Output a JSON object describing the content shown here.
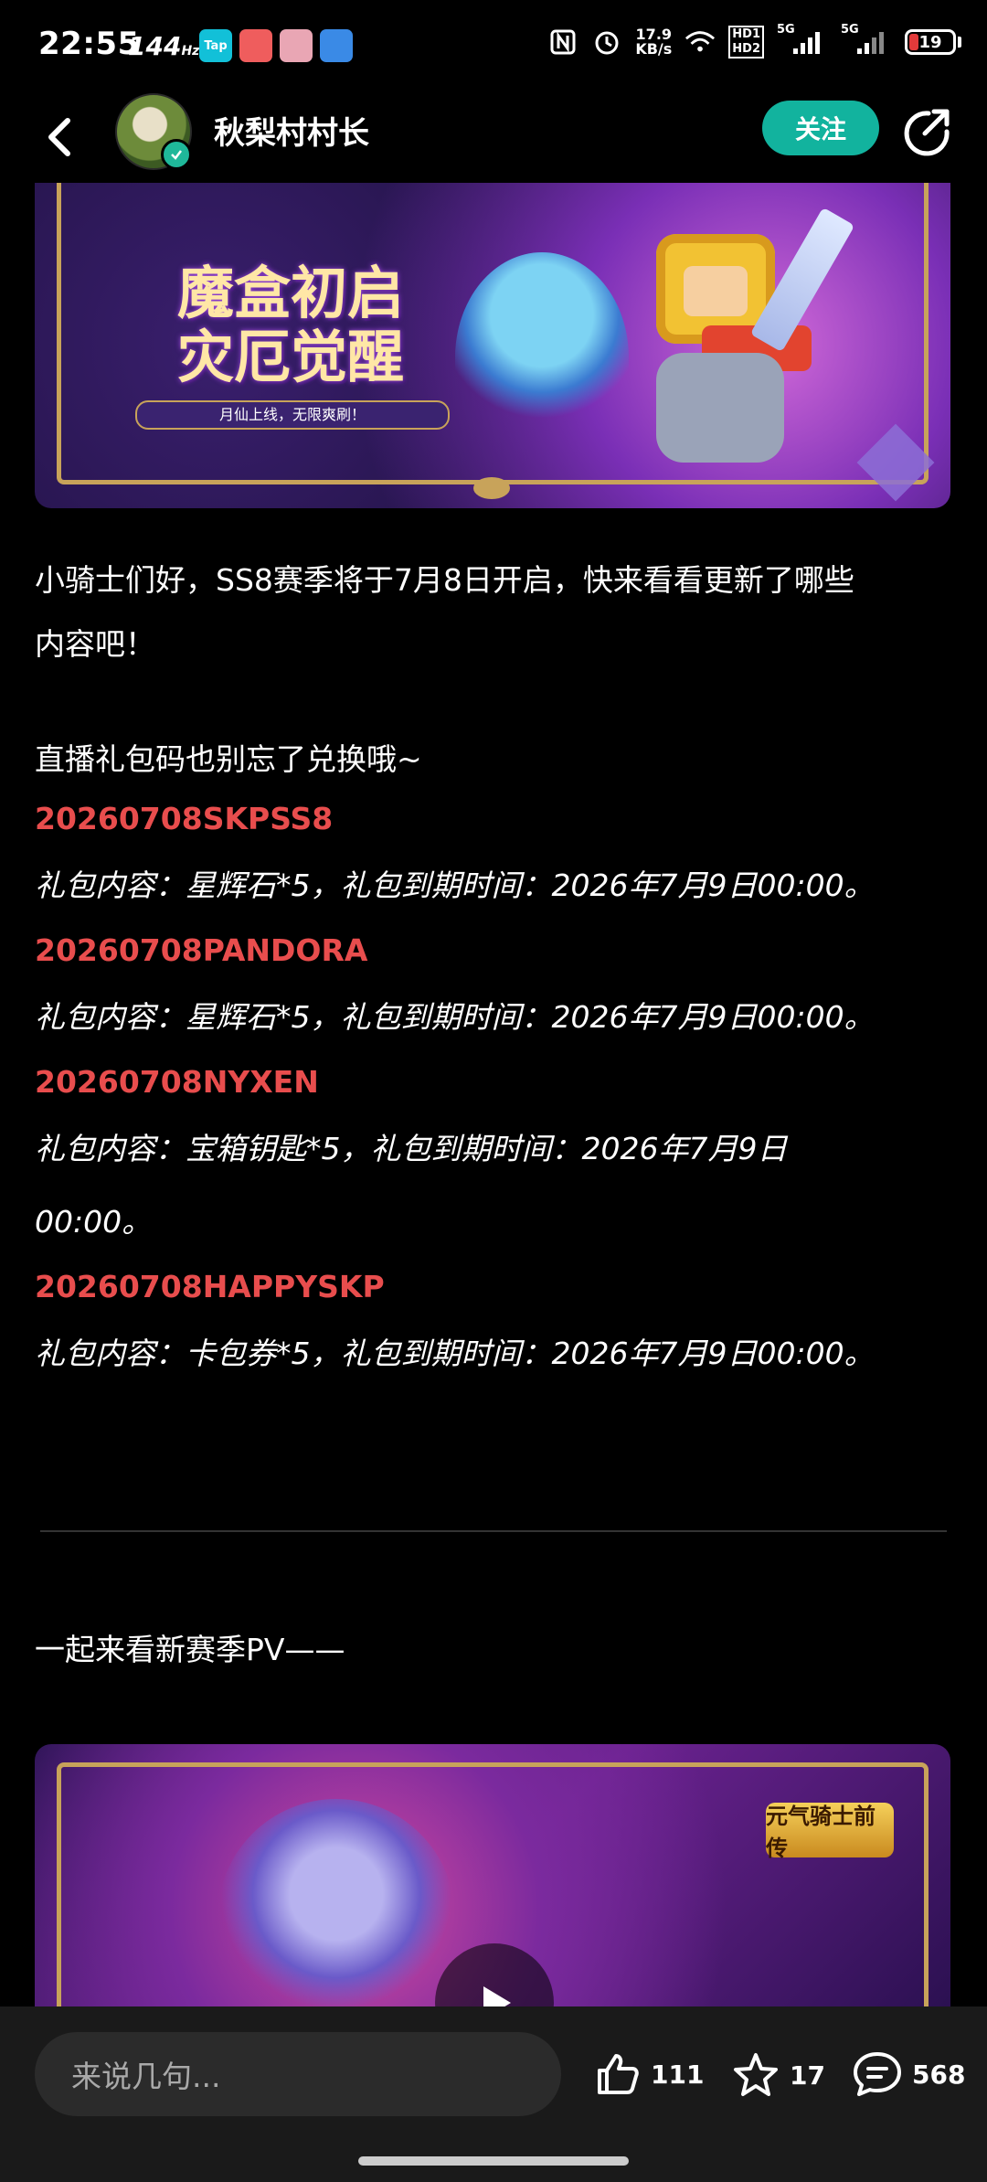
{
  "status_bar": {
    "time": "22:55",
    "refresh_rate": "144",
    "refresh_unit": "Hz",
    "net_speed_value": "17.9",
    "net_speed_unit": "KB/s",
    "hd1": "HD1",
    "hd2": "HD2",
    "sig1": "5G",
    "sig2": "5G",
    "battery": "19",
    "app_icons": [
      "tap-icon",
      "game-icon",
      "avatar-app-icon",
      "download-icon"
    ]
  },
  "header": {
    "author_name": "秋梨村村长",
    "follow_label": "关注"
  },
  "banner1": {
    "title_line1": "魔盒初启",
    "title_line2": "灾厄觉醒",
    "subtitle": "月仙上线，无限爽刷！"
  },
  "article": {
    "intro_line1": "小骑士们好，SS8赛季将于7月8日开启，快来看看更新了哪些",
    "intro_line2": "内容吧！",
    "reminder": "直播礼包码也别忘了兑换哦~",
    "codes": [
      {
        "code": "20260708SKPSS8",
        "content": "礼包内容：星辉石*5，礼包到期时间：2026年7月9日00:00。"
      },
      {
        "code": "20260708PANDORA",
        "content": "礼包内容：星辉石*5，礼包到期时间：2026年7月9日00:00。"
      },
      {
        "code": "20260708NYXEN",
        "content_line1": "礼包内容：宝箱钥匙*5，礼包到期时间：2026年7月9日",
        "content_line2": "00:00。"
      },
      {
        "code": "20260708HAPPYSKP",
        "content": "礼包内容：卡包券*5，礼包到期时间：2026年7月9日00:00。"
      }
    ],
    "pv_text": "一起来看新赛季PV——"
  },
  "banner2": {
    "logo_text": "元气骑士前传"
  },
  "bottom_bar": {
    "comment_placeholder": "来说几句...",
    "likes": "111",
    "favorites": "17",
    "comments": "568"
  },
  "colors": {
    "accent": "#12b39e",
    "code_red": "#e84d4d",
    "background": "#000000"
  }
}
